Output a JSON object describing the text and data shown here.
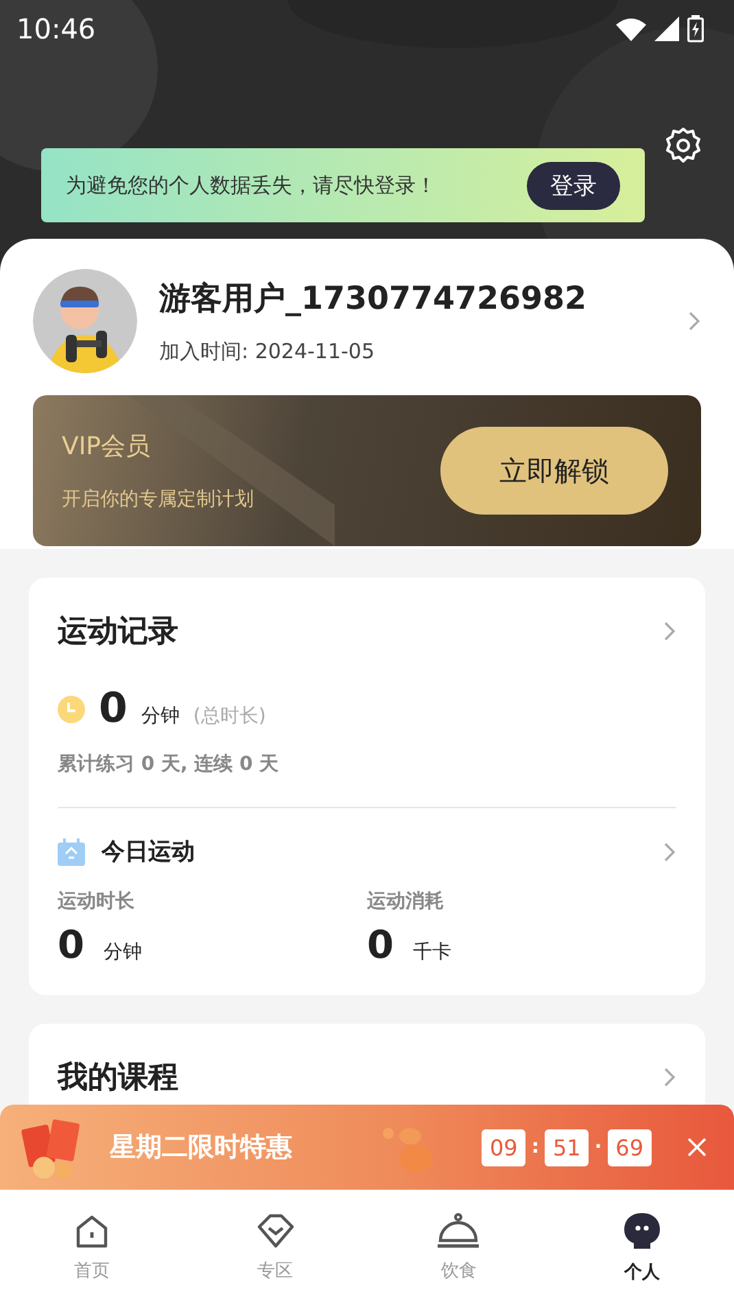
{
  "status_bar": {
    "time": "10:46"
  },
  "login_banner": {
    "message": "为避免您的个人数据丢失，请尽快登录！",
    "button": "登录"
  },
  "profile": {
    "name": "游客用户_1730774726982",
    "joined": "加入时间: 2024-11-05"
  },
  "vip": {
    "title": "VIP会员",
    "subtitle": "开启你的专属定制计划",
    "button": "立即解锁"
  },
  "records": {
    "title": "运动记录",
    "total_value": "0",
    "total_unit": "分钟",
    "total_note": "(总时长)",
    "summary": "累计练习 0 天, 连续 0 天",
    "today": {
      "title": "今日运动",
      "stats": [
        {
          "label": "运动时长",
          "value": "0",
          "unit": "分钟"
        },
        {
          "label": "运动消耗",
          "value": "0",
          "unit": "千卡"
        }
      ]
    }
  },
  "courses": {
    "title": "我的课程"
  },
  "promo": {
    "title": "星期二限时特惠",
    "countdown": [
      "09",
      ":",
      "51",
      "·",
      "69"
    ]
  },
  "tabs": [
    {
      "label": "首页",
      "kind": "home",
      "selected": false
    },
    {
      "label": "专区",
      "kind": "zone",
      "selected": false
    },
    {
      "label": "饮食",
      "kind": "food",
      "selected": false
    },
    {
      "label": "个人",
      "kind": "me",
      "selected": true
    }
  ]
}
